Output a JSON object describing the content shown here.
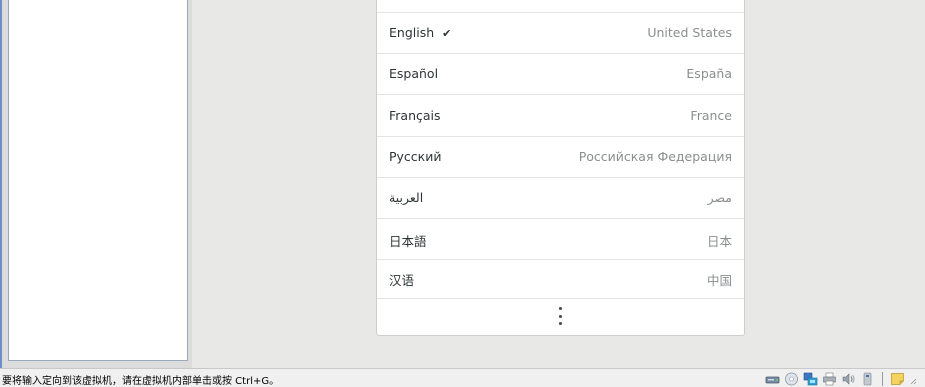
{
  "languages": [
    {
      "name": "English",
      "region": "United States",
      "selected": true
    },
    {
      "name": "Español",
      "region": "España",
      "selected": false
    },
    {
      "name": "Français",
      "region": "France",
      "selected": false
    },
    {
      "name": "Русский",
      "region": "Российская Федерация",
      "selected": false
    },
    {
      "name": "العربية",
      "region": "مصر",
      "selected": false
    },
    {
      "name": "日本語",
      "region": "日本",
      "selected": false
    },
    {
      "name": "汉语",
      "region": "中国",
      "selected": false
    }
  ],
  "check_glyph": "✔",
  "status": {
    "hint": "要将输入定向到该虚拟机，请在虚拟机内部单击或按 Ctrl+G。"
  },
  "tray_icons": [
    "hard-disk-icon",
    "cd-rom-icon",
    "network-adapter-icon",
    "printer-icon",
    "sound-icon",
    "usb-icon",
    "message-icon"
  ],
  "colors": {
    "accent": "#6b8fc9",
    "selected_check": "#2e3436",
    "region_text": "#8b8e8f"
  }
}
